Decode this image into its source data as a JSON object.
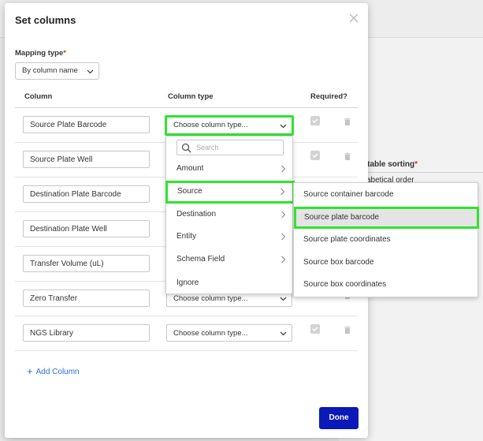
{
  "background": {
    "table_sorting_label": "t table sorting",
    "sorting_value": "abetical order"
  },
  "modal": {
    "title": "Set columns",
    "mapping_type": {
      "label": "Mapping type",
      "value": "By column name"
    },
    "table": {
      "headers": [
        "Column",
        "Column type",
        "Required?"
      ],
      "rows": [
        {
          "name": "Source Plate Barcode",
          "type": "Choose column type..."
        },
        {
          "name": "Source Plate Well",
          "type": ""
        },
        {
          "name": "Destination Plate Barcode",
          "type": ""
        },
        {
          "name": "Destination Plate Well",
          "type": ""
        },
        {
          "name": "Transfer Volume (uL)",
          "type": ""
        },
        {
          "name": "Zero Transfer",
          "type": "Choose column type..."
        },
        {
          "name": "NGS Library",
          "type": "Choose column type..."
        }
      ]
    },
    "add_column_label": "Add Column",
    "done_label": "Done"
  },
  "dropdown": {
    "search_placeholder": "Search",
    "items": [
      "Amount",
      "Source",
      "Destination",
      "Entity",
      "Schema Field",
      "Ignore"
    ]
  },
  "submenu": {
    "items": [
      "Source container barcode",
      "Source plate barcode",
      "Source plate coordinates",
      "Source box barcode",
      "Source box coordinates"
    ]
  },
  "colors": {
    "highlight": "#2ee52e",
    "primary_button": "#0a19b8",
    "link": "#2a6fd6",
    "required_star": "#c0392b"
  }
}
